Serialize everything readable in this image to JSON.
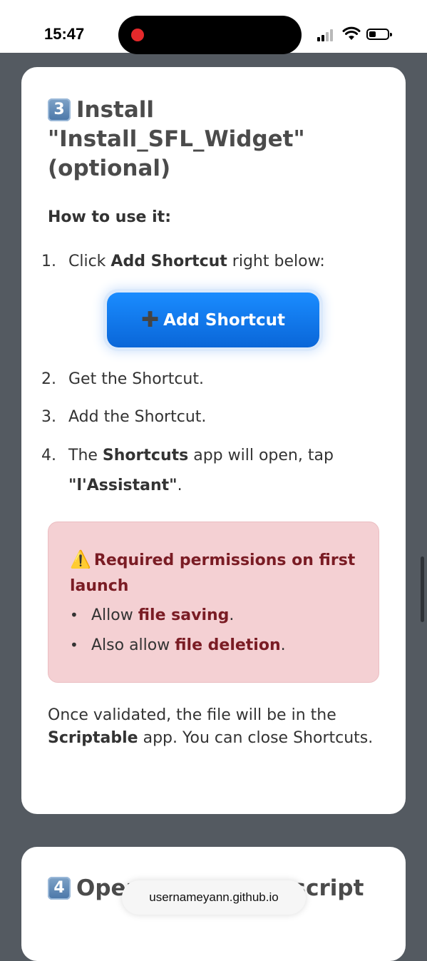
{
  "status": {
    "time": "15:47"
  },
  "section3": {
    "number": "3",
    "title": "Install \"Install_SFL_Widget\" (optional)",
    "how_to": "How to use it:",
    "steps": [
      {
        "num": "1.",
        "pre": "Click ",
        "bold": "Add Shortcut",
        "post": " right below:"
      },
      {
        "num": "2.",
        "text": "Get the Shortcut."
      },
      {
        "num": "3.",
        "text": "Add the Shortcut."
      },
      {
        "num": "4.",
        "pre": "The ",
        "bold": "Shortcuts",
        "post": " app will open, tap",
        "line2_bold": "\"l'Assistant\"",
        "line2_post": "."
      }
    ],
    "add_button": "Add Shortcut",
    "warning": {
      "title": "Required permissions on first launch",
      "items": [
        {
          "pre": "Allow ",
          "bold": "file saving",
          "post": "."
        },
        {
          "pre": "Also allow ",
          "bold": "file deletion",
          "post": "."
        }
      ]
    },
    "final": {
      "pre": "Once validated, the file will be in the ",
      "bold": "Scriptable",
      "post": " app. You can close Shortcuts."
    }
  },
  "section4": {
    "number": "4",
    "title": "Open",
    "title_end": "script"
  },
  "browser": {
    "url": "usernameyann.github.io"
  },
  "colors": {
    "accent": "#0a66d8",
    "warning_bg": "#f4d0d3",
    "warning_text": "#7a1c24"
  },
  "icons": [
    "recording-dot-icon",
    "cellular-signal-icon",
    "wifi-icon",
    "battery-icon",
    "plus-icon",
    "warning-icon"
  ]
}
